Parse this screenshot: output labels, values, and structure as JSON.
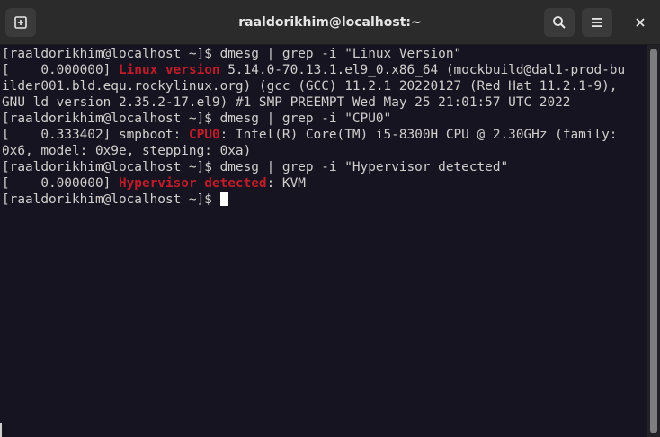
{
  "window": {
    "title": "raaldorikhim@localhost:~"
  },
  "icons": {
    "new_tab": "new-tab-icon",
    "search": "search-icon",
    "menu": "hamburger-menu-icon",
    "close": "close-icon"
  },
  "colors": {
    "background": "#171421",
    "text": "#d0cfcc",
    "highlight": "#c01c28",
    "titlebar": "#2b2b2b"
  },
  "terminal": {
    "lines": [
      [
        {
          "t": "[raaldorikhim@localhost ~]$ dmesg | grep -i \"Linux Version\""
        }
      ],
      [
        {
          "t": "[    0.000000] "
        },
        {
          "t": "Linux version",
          "hl": true
        },
        {
          "t": " 5.14.0-70.13.1.el9_0.x86_64 (mockbuild@dal1-prod-bu"
        }
      ],
      [
        {
          "t": "ilder001.bld.equ.rockylinux.org) (gcc (GCC) 11.2.1 20220127 (Red Hat 11.2.1-9),"
        }
      ],
      [
        {
          "t": "GNU ld version 2.35.2-17.el9) #1 SMP PREEMPT Wed May 25 21:01:57 UTC 2022"
        }
      ],
      [
        {
          "t": "[raaldorikhim@localhost ~]$ dmesg | grep -i \"CPU0\""
        }
      ],
      [
        {
          "t": "[    0.333402] smpboot: "
        },
        {
          "t": "CPU0",
          "hl": true
        },
        {
          "t": ": Intel(R) Core(TM) i5-8300H CPU @ 2.30GHz (family:"
        }
      ],
      [
        {
          "t": "0x6, model: 0x9e, stepping: 0xa)"
        }
      ],
      [
        {
          "t": "[raaldorikhim@localhost ~]$ dmesg | grep -i \"Hypervisor detected\""
        }
      ],
      [
        {
          "t": "[    0.000000] "
        },
        {
          "t": "Hypervisor detected",
          "hl": true
        },
        {
          "t": ": KVM"
        }
      ],
      [
        {
          "t": "[raaldorikhim@localhost ~]$ "
        }
      ]
    ]
  }
}
